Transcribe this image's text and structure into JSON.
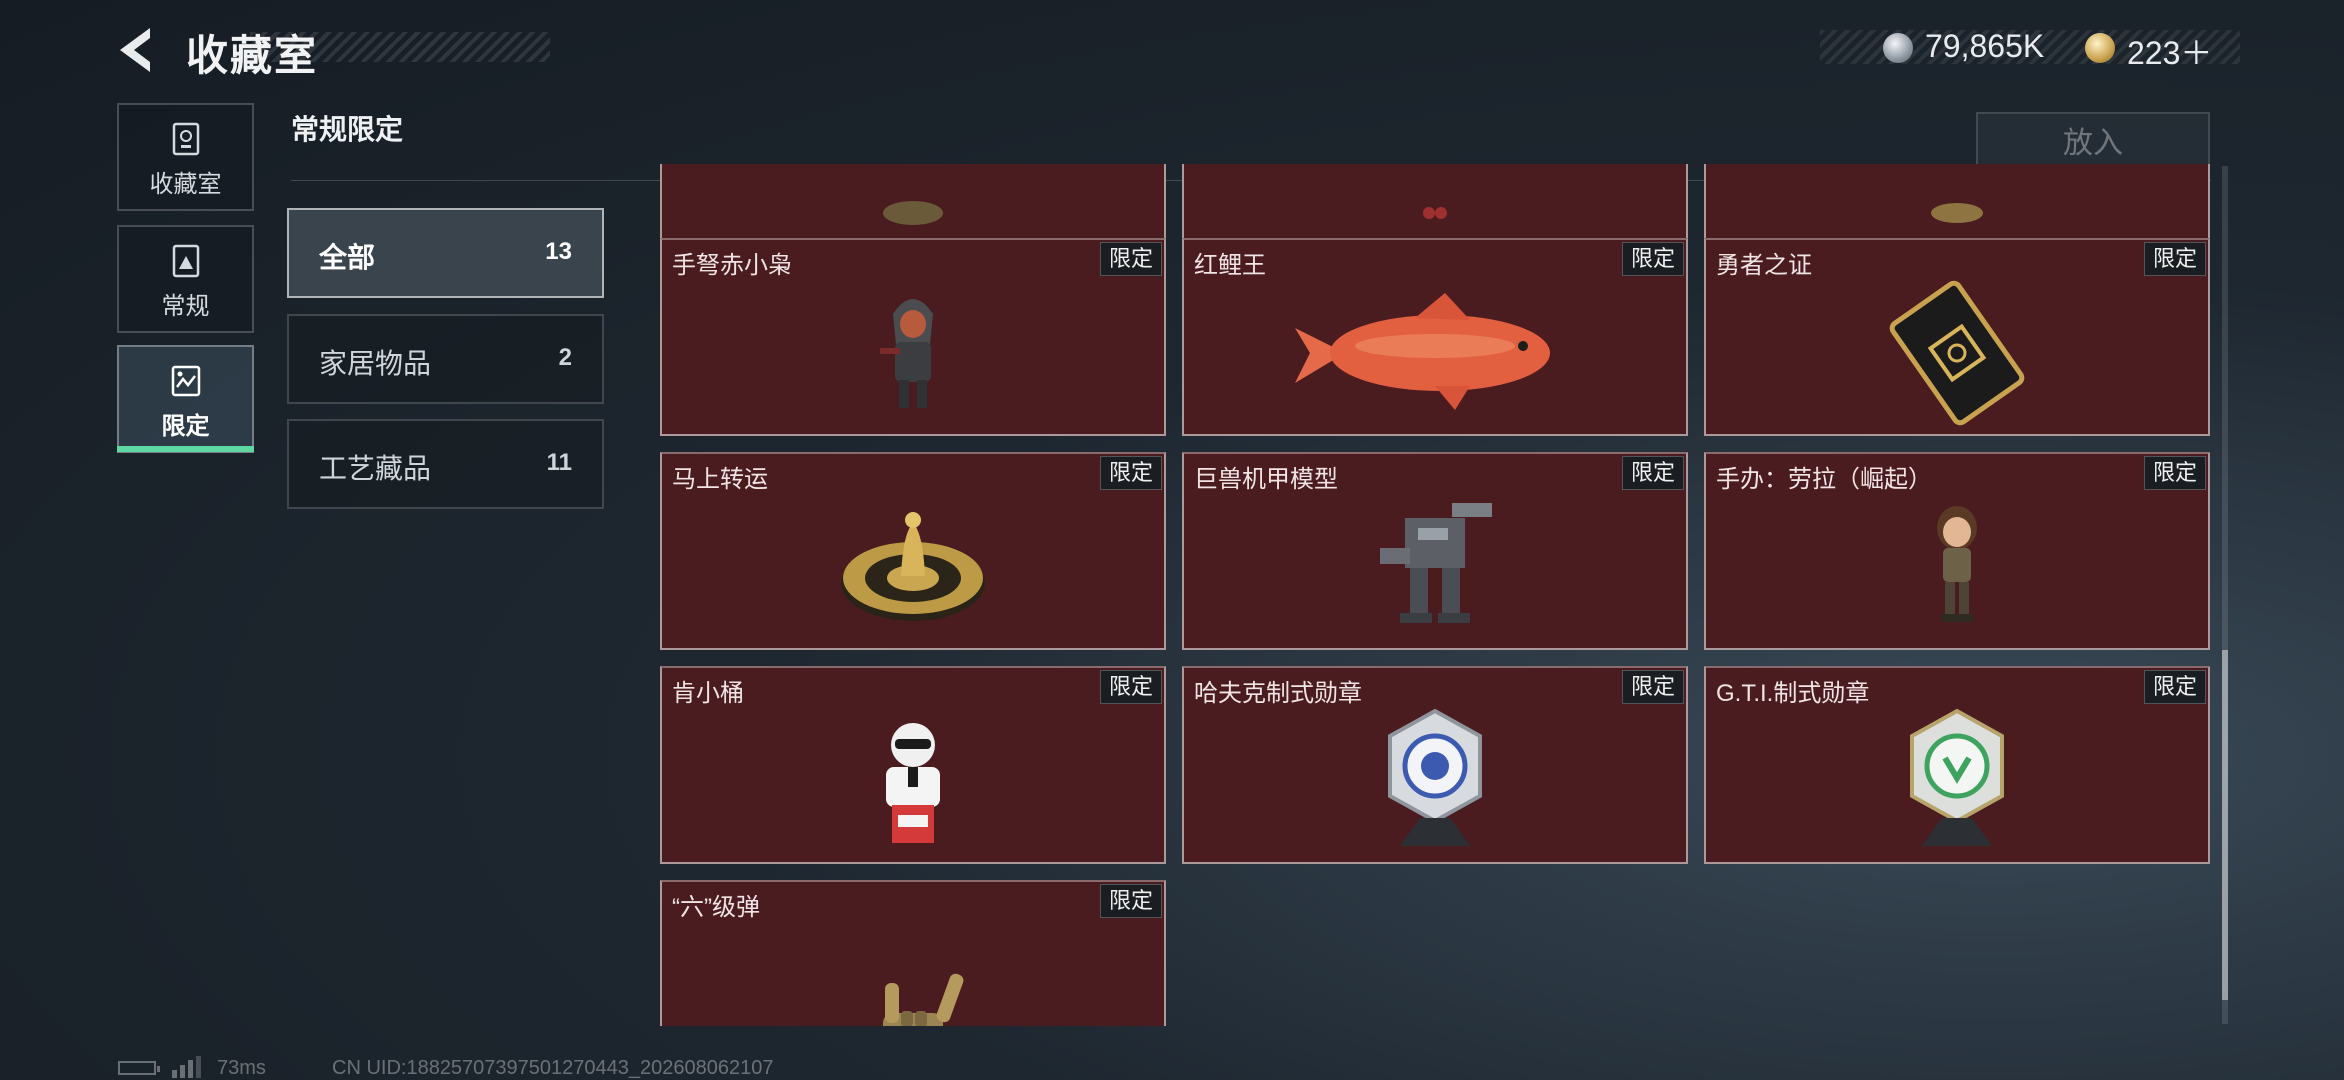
{
  "header": {
    "title": "收藏室",
    "currency": [
      {
        "icon": "silver-coin-icon",
        "value": "79,865K"
      },
      {
        "icon": "gold-gem-icon",
        "value": "223＋"
      }
    ]
  },
  "sidebar": {
    "items": [
      {
        "label": "收藏室",
        "icon": "trophy-icon",
        "selected": false
      },
      {
        "label": "常规",
        "icon": "image-frame-icon",
        "selected": false
      },
      {
        "label": "限定",
        "icon": "landscape-icon",
        "selected": true
      }
    ]
  },
  "section": {
    "title": "常规限定",
    "place_button": "放入"
  },
  "categories": [
    {
      "name": "全部",
      "count": "13",
      "selected": true
    },
    {
      "name": "家居物品",
      "count": "2",
      "selected": false
    },
    {
      "name": "工艺藏品",
      "count": "11",
      "selected": false
    }
  ],
  "items": [
    {
      "name": "",
      "badge": "",
      "icon": "partial-item-icon"
    },
    {
      "name": "",
      "badge": "",
      "icon": "partial-item-icon"
    },
    {
      "name": "",
      "badge": "",
      "icon": "partial-item-icon"
    },
    {
      "name": "手弩赤小枭",
      "badge": "限定",
      "icon": "hooded-figurine-icon"
    },
    {
      "name": "红鲤王",
      "badge": "限定",
      "icon": "red-carp-icon"
    },
    {
      "name": "勇者之证",
      "badge": "限定",
      "icon": "gold-card-icon"
    },
    {
      "name": "马上转运",
      "badge": "限定",
      "icon": "gold-wheel-icon"
    },
    {
      "name": "巨兽机甲模型",
      "badge": "限定",
      "icon": "mech-model-icon"
    },
    {
      "name": "手办：劳拉（崛起）",
      "badge": "限定",
      "icon": "lara-figurine-icon"
    },
    {
      "name": "肯小桶",
      "badge": "限定",
      "icon": "colonel-figurine-icon"
    },
    {
      "name": "哈夫克制式勋章",
      "badge": "限定",
      "icon": "blue-medal-icon"
    },
    {
      "name": "G.T.I.制式勋章",
      "badge": "限定",
      "icon": "green-medal-icon"
    },
    {
      "name": "“六”级弹",
      "badge": "限定",
      "icon": "golden-hand-icon"
    }
  ],
  "footer": {
    "ping": "73ms",
    "uid": "CN UID:18825707397501270443_202608062107"
  },
  "colors": {
    "card_bg": "#4a1c20",
    "accent_green": "#5fd8a4",
    "badge_bg": "#1a1d21"
  }
}
